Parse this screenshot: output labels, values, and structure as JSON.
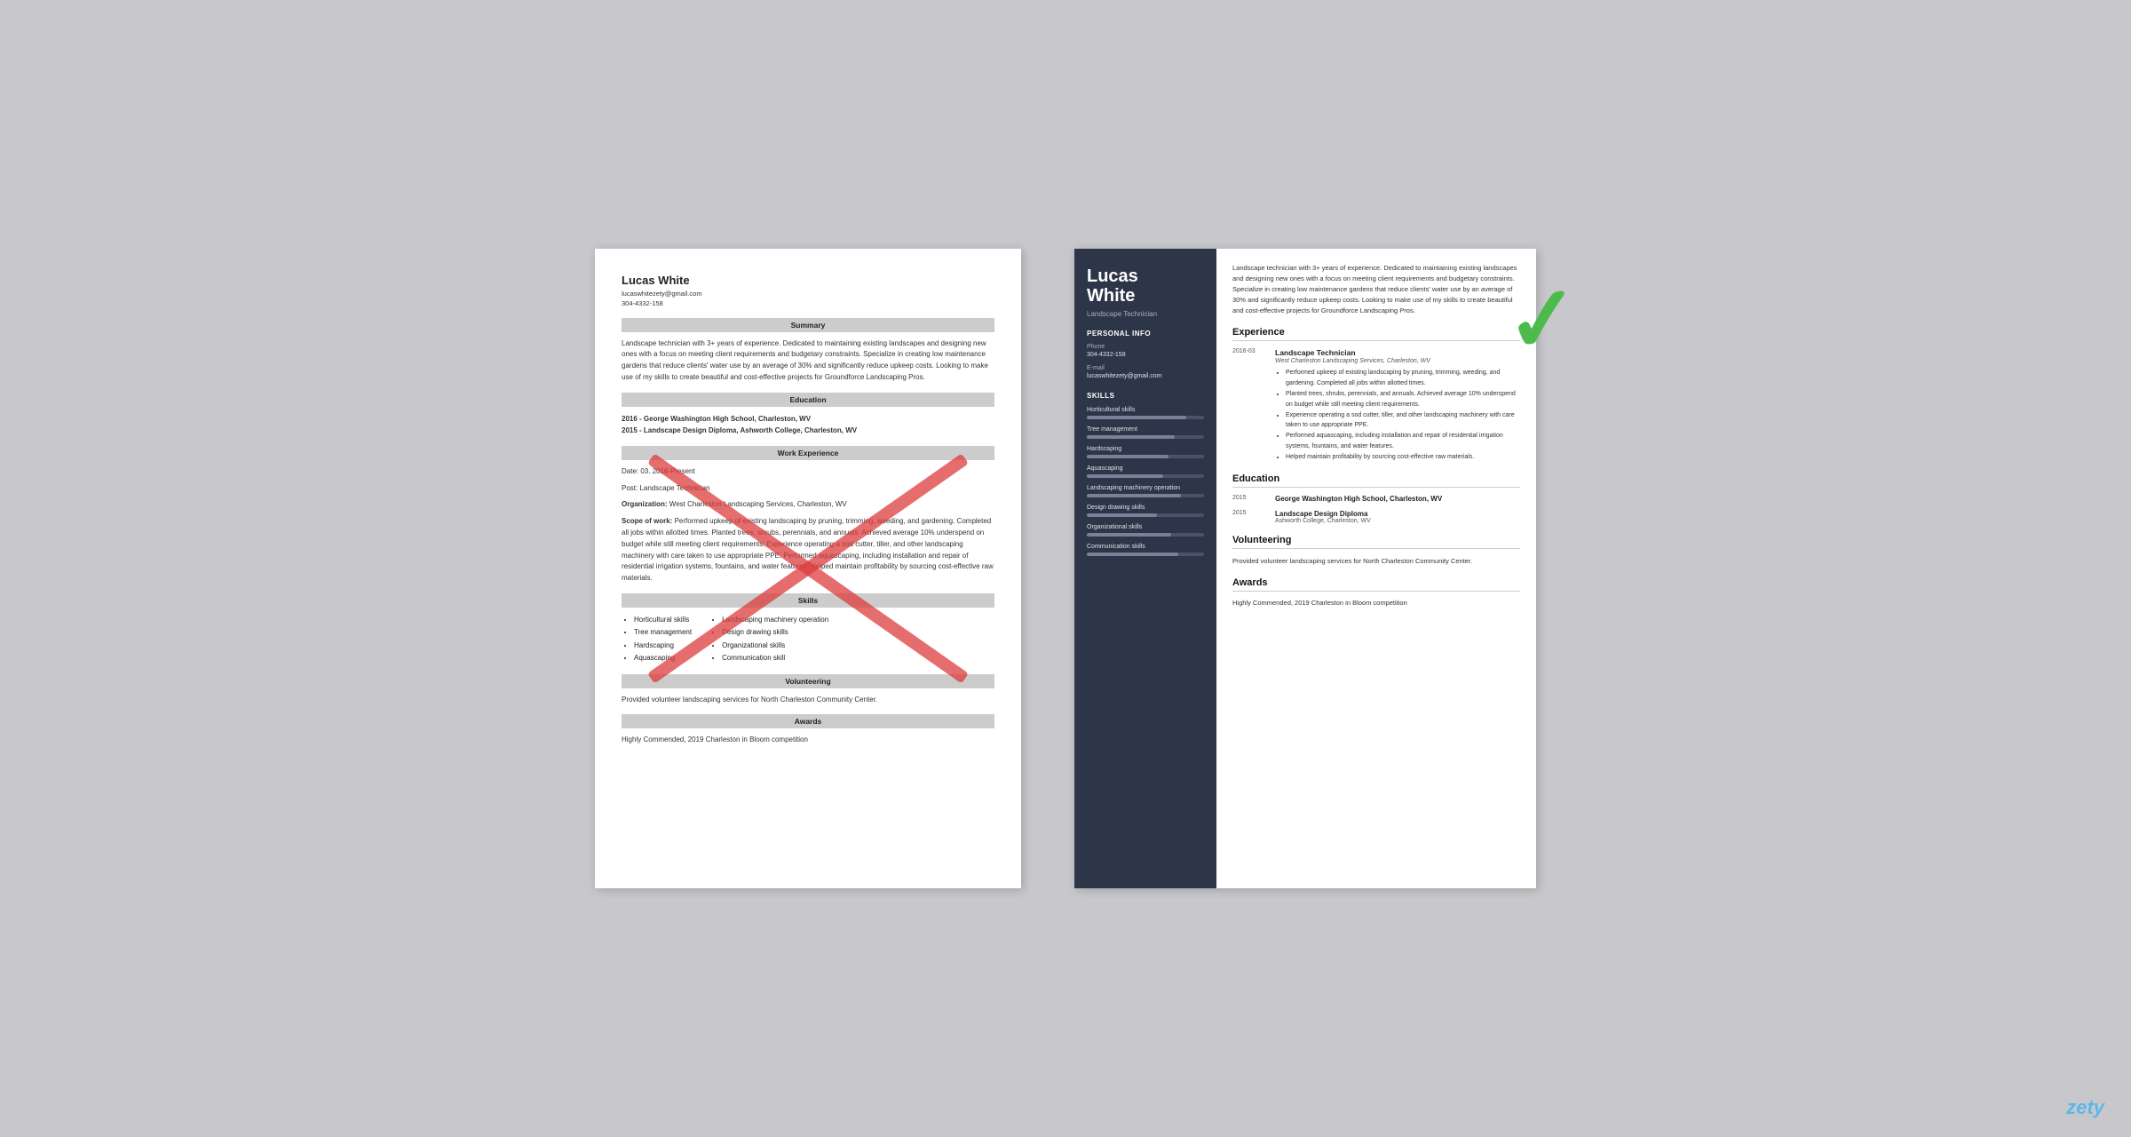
{
  "left_resume": {
    "name": "Lucas White",
    "email": "lucaswhitezety@gmail.com",
    "phone": "304-4332-158",
    "sections": {
      "summary_header": "Summary",
      "summary_text": "Landscape technician with 3+ years of experience. Dedicated to maintaining existing landscapes and designing new ones with a focus on meeting client requirements and budgetary constraints. Specialize in creating low maintenance gardens that reduce clients' water use by an average of 30% and significantly reduce upkeep costs. Looking to make use of my skills to create beautiful and cost-effective projects for Groundforce Landscaping Pros.",
      "education_header": "Education",
      "education_items": [
        "2016 - George Washington High School, Charleston, WV",
        "2015 - Landscape Design Diploma, Ashworth College, Charleston, WV"
      ],
      "work_header": "Work Experience",
      "work_date": "Date: 03. 2016-Present",
      "work_post": "Post: Landscape Technician",
      "work_org": "Organization: West Charleston Landscaping Services, Charleston, WV",
      "work_scope_label": "Scope of work:",
      "work_scope_text": "Performed upkeep of existing landscaping by pruning, trimming, weeding, and gardening. Completed all jobs within allotted times. Planted trees, shrubs, perennials, and annuals. Achieved average 10% underspend on budget while still meeting client requirements. Experience operating a sod cutter, tiller, and other landscaping machinery with care taken to use appropriate PPE. Performed aquascaping, including installation and repair of residential irrigation systems, fountains, and water features. Helped maintain profitability by sourcing cost-effective raw materials.",
      "skills_header": "Skills",
      "skills_left": [
        "Horticultural skills",
        "Tree management",
        "Hardscaping",
        "Aquascaping"
      ],
      "skills_right": [
        "Landscaping machinery operation",
        "Design drawing skills",
        "Organizational skills",
        "Communication skill"
      ],
      "volunteering_header": "Volunteering",
      "volunteering_text": "Provided volunteer landscaping services for North Charleston Community Center.",
      "awards_header": "Awards",
      "awards_text": "Highly Commended, 2019 Charleston in Bloom competition"
    }
  },
  "right_resume": {
    "first_name": "Lucas",
    "last_name": "White",
    "title": "Landscape Technician",
    "sidebar": {
      "personal_info_header": "Personal Info",
      "phone_label": "Phone",
      "phone_value": "304-4332-158",
      "email_label": "E-mail",
      "email_value": "lucaswhitezety@gmail.com",
      "skills_header": "Skills",
      "skills": [
        {
          "name": "Horticultural skills",
          "level": 85
        },
        {
          "name": "Tree management",
          "level": 75
        },
        {
          "name": "Hardscaping",
          "level": 70
        },
        {
          "name": "Aquascaping",
          "level": 65
        },
        {
          "name": "Landscaping machinery operation",
          "level": 80
        },
        {
          "name": "Design drawing skills",
          "level": 60
        },
        {
          "name": "Organizational skills",
          "level": 72
        },
        {
          "name": "Communication skills",
          "level": 78
        }
      ]
    },
    "summary_text": "Landscape technician with 3+ years of experience. Dedicated to maintaining existing landscapes and designing new ones with a focus on meeting client requirements and budgetary constraints. Specialize in creating low maintenance gardens that reduce clients' water use by an average of 30% and significantly reduce upkeep costs. Looking to make use of my skills to create beautiful and cost-effective projects for Groundforce Landscaping Pros.",
    "experience_header": "Experience",
    "experience": [
      {
        "date": "2016-03",
        "title": "Landscape Technician",
        "company": "West Charleston Landscaping Services, Charleston, WV",
        "bullets": [
          "Performed upkeep of existing landscaping by pruning, trimming, weeding, and gardening. Completed all jobs within allotted times.",
          "Planted trees, shrubs, perennials, and annuals. Achieved average 10% underspend on budget while still meeting client requirements.",
          "Experience operating a sod cutter, tiller, and other landscaping machinery with care taken to use appropriate PPE.",
          "Performed aquascaping, including installation and repair of residential irrigation systems, fountains, and water features.",
          "Helped maintain profitability by sourcing cost-effective raw materials."
        ]
      }
    ],
    "education_header": "Education",
    "education": [
      {
        "year": "2015",
        "school": "George Washington High School, Charleston, WV",
        "degree": null,
        "sub": null
      },
      {
        "year": "2015",
        "school": null,
        "degree": "Landscape Design Diploma",
        "sub": "Ashworth College, Charleston, WV"
      }
    ],
    "volunteering_header": "Volunteering",
    "volunteering_text": "Provided volunteer landscaping services for North Charleston Community Center.",
    "awards_header": "Awards",
    "awards_text": "Highly Commended, 2019 Charleston in Bloom competition"
  },
  "brand": "zety"
}
